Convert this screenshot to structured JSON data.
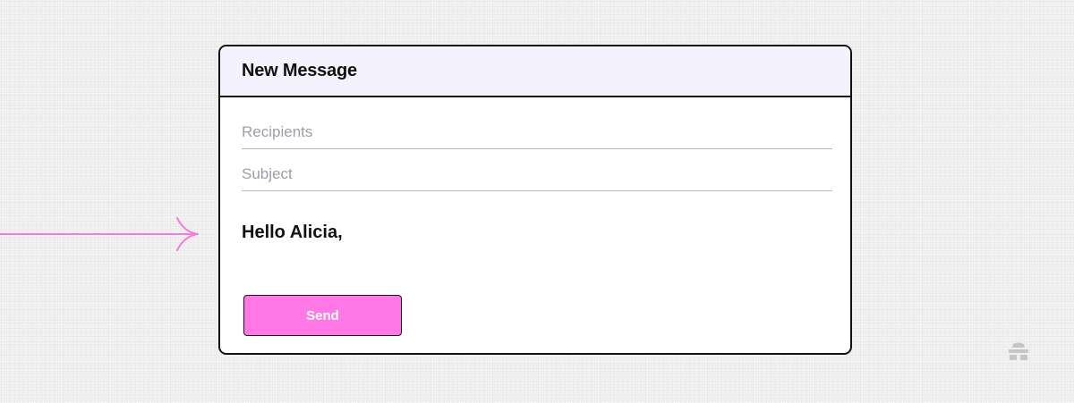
{
  "compose": {
    "title": "New Message",
    "recipients_placeholder": "Recipients",
    "subject_placeholder": "Subject",
    "body_text": "Hello Alicia,",
    "send_label": "Send"
  },
  "colors": {
    "background": "#f1f1f1",
    "header_background": "#f4f2fd",
    "send_button": "#ff78e6",
    "arrow": "#f07ddc",
    "logo": "#c6c6c6",
    "border": "#111111"
  },
  "icons": {
    "pointer_arrow": "arrow-right-icon",
    "brand_logo": "beehive-logo-icon"
  }
}
